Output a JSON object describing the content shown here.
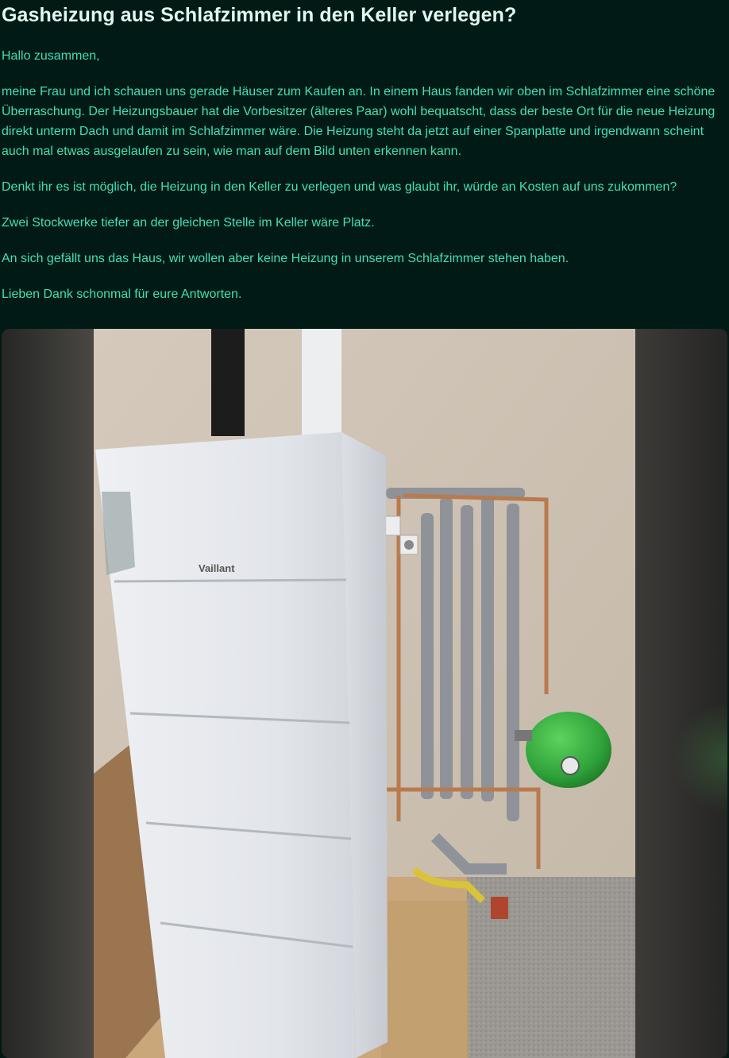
{
  "post": {
    "title": "Gasheizung aus Schlafzimmer in den Keller verlegen?",
    "paragraphs": [
      "Hallo zusammen,",
      "meine Frau und ich schauen uns gerade Häuser zum Kaufen an. In einem Haus fanden wir oben im Schlafzimmer eine schöne Überraschung. Der Heizungsbauer hat die Vorbesitzer (älteres Paar) wohl bequatscht, dass der beste Ort für die neue Heizung direkt unterm Dach und damit im Schlafzimmer wäre. Die Heizung steht da jetzt auf einer Spanplatte und irgendwann scheint auch mal etwas ausgelaufen zu sein, wie man auf dem Bild unten erkennen kann.",
      "Denkt ihr es ist möglich, die Heizung in den Keller zu verlegen und was glaubt ihr, würde an Kosten auf uns zukommen?",
      "Zwei Stockwerke tiefer an der gleichen Stelle im Keller wäre Platz.",
      "An sich gefällt uns das Haus, wir wollen aber keine Heizung in unserem Schlafzimmer stehen haben.",
      "Lieben Dank schonmal für eure Antworten."
    ],
    "image": {
      "brand_text": "Vaillant"
    }
  },
  "colors": {
    "background": "#021a16",
    "title": "#dff7ee",
    "body_text": "#3fe0b6"
  }
}
